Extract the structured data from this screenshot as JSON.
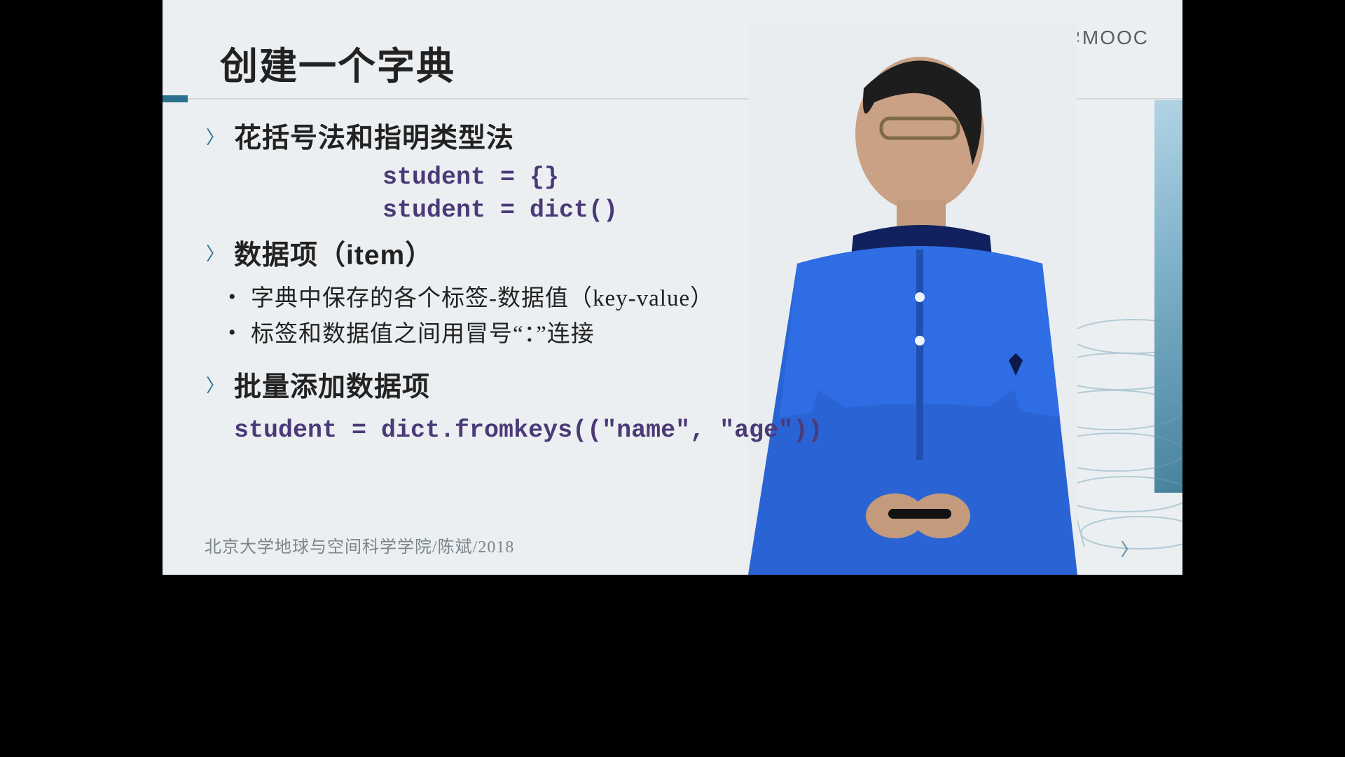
{
  "watermark": {
    "text_cn": "中国大学",
    "text_en": "MOOC"
  },
  "title": "创建一个字典",
  "section1": {
    "heading": "花括号法和指明类型法",
    "code_line1": "student = {}",
    "code_line2": "student = dict()"
  },
  "section2": {
    "heading": "数据项（item）",
    "bullet1": "字典中保存的各个标签-数据值（key-value）",
    "bullet2": "标签和数据值之间用冒号“：”连接"
  },
  "section3": {
    "heading": "批量添加数据项",
    "code": "student = dict.fromkeys((\"name\", \"age\"))"
  },
  "footer": "北京大学地球与空间科学学院/陈斌/2018"
}
